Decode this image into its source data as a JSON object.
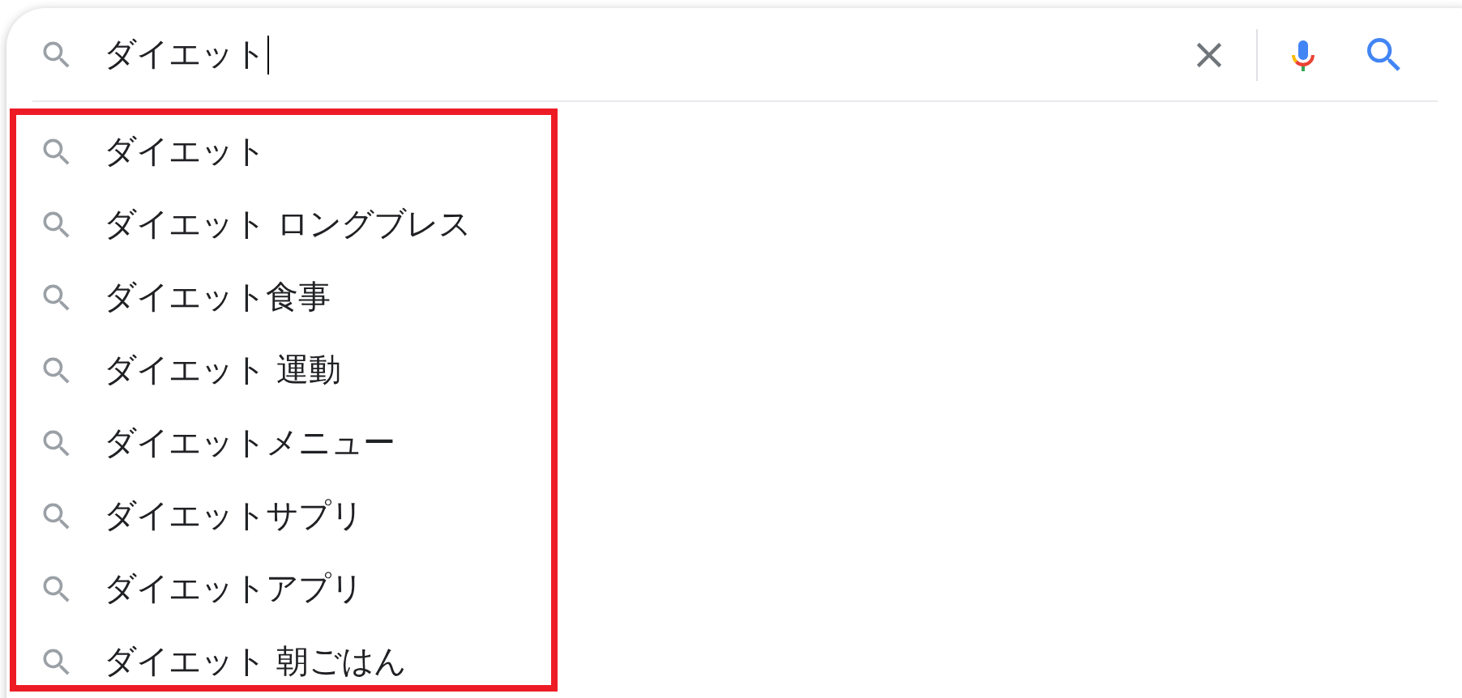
{
  "search": {
    "value": "ダイエット"
  },
  "suggestions": [
    {
      "text": "ダイエット"
    },
    {
      "text": "ダイエット ロングブレス"
    },
    {
      "text": "ダイエット食事"
    },
    {
      "text": "ダイエット 運動"
    },
    {
      "text": "ダイエットメニュー"
    },
    {
      "text": "ダイエットサプリ"
    },
    {
      "text": "ダイエットアプリ"
    },
    {
      "text": "ダイエット 朝ごはん"
    }
  ]
}
